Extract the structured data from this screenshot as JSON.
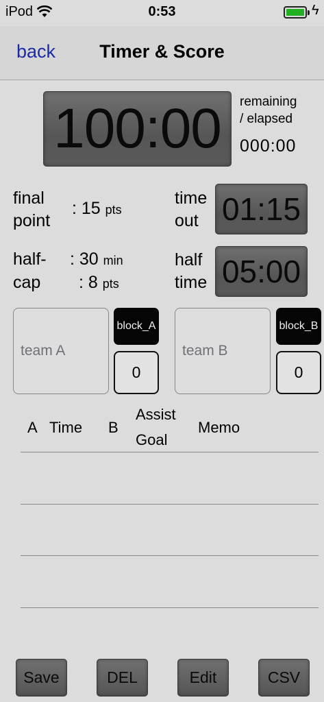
{
  "status": {
    "carrier": "iPod",
    "time": "0:53",
    "charge_glyph": "ϟ"
  },
  "nav": {
    "back_label": "back",
    "title": "Timer & Score"
  },
  "timer": {
    "main": "100:00",
    "remaining_line1": "remaining",
    "remaining_line2": "/ elapsed",
    "elapsed": "000:00"
  },
  "settings": {
    "final_label1": "final",
    "final_label2": "point",
    "final_value": ": 15",
    "final_unit": "pts",
    "half_label1": "half-",
    "half_value": ": 30",
    "half_unit": "min",
    "cap_label": "cap",
    "cap_value": ": 8",
    "cap_unit": "pts",
    "timeout_label1": "time",
    "timeout_label2": "out",
    "timeout_value": "01:15",
    "halftime_label1": "half",
    "halftime_label2": "time",
    "halftime_value": "05:00"
  },
  "teams": {
    "a": {
      "placeholder": "team A",
      "block_label": "block_A",
      "count": "0"
    },
    "b": {
      "placeholder": "team B",
      "block_label": "block_B",
      "count": "0"
    }
  },
  "log_header": {
    "a": "A",
    "time": "Time",
    "b": "B",
    "assist": "Assist",
    "goal": "Goal",
    "memo": "Memo"
  },
  "buttons": {
    "save": "Save",
    "del": "DEL",
    "edit": "Edit",
    "csv": "CSV"
  }
}
